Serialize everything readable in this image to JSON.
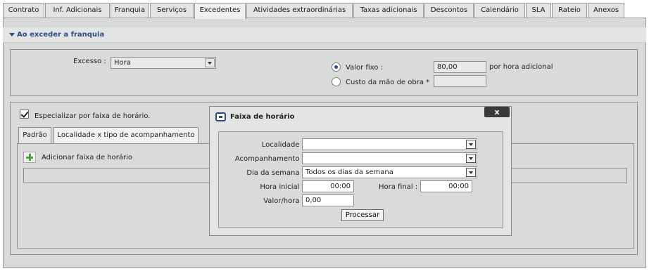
{
  "tabs": [
    "Contrato",
    "Inf. Adicionais",
    "Franquia",
    "Serviços",
    "Excedentes",
    "Atividades extraordinárias",
    "Taxas adicionais",
    "Descontos",
    "Calendário",
    "SLA",
    "Rateio",
    "Anexos"
  ],
  "section": {
    "title": "Ao exceder a franquia"
  },
  "excess": {
    "label": "Excesso :",
    "value": "Hora",
    "fixed_label": "Valor fixo :",
    "fixed_value": "80,00",
    "fixed_suffix": "por hora adicional",
    "labor_label": "Custo da mão de obra *",
    "labor_value": ""
  },
  "specialize": {
    "label": "Especializar por faixa de horário."
  },
  "inner_tabs": [
    "Padrão",
    "Localidade x tipo de acompanhamento"
  ],
  "add_range": {
    "label": "Adicionar faixa de horário"
  },
  "modal": {
    "title": "Faixa de horário",
    "close": "x",
    "locality_label": "Localidade :",
    "locality_value": "",
    "tracking_label": "Acompanhamento :",
    "tracking_value": "",
    "weekday_label": "Dia da semana :",
    "weekday_value": "Todos os dias da semana",
    "start_label": "Hora inicial :",
    "start_value": "00:00",
    "end_label": "Hora final :",
    "end_value": "00:00",
    "rate_label": "Valor/hora :",
    "rate_value": "0,00",
    "submit": "Processar"
  }
}
